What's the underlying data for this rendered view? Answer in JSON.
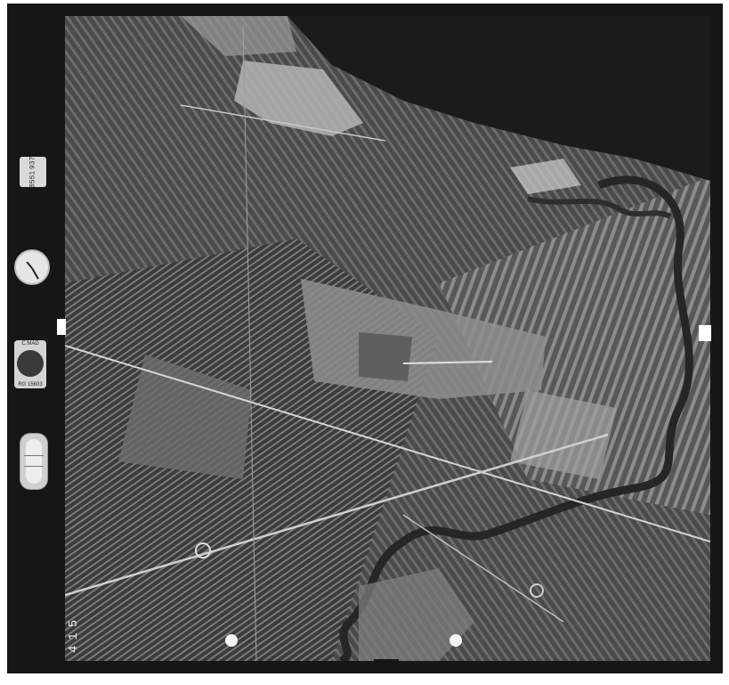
{
  "frame": {
    "number": "415",
    "counter_text": [
      "0551",
      "937"
    ]
  },
  "instruments": {
    "clock_icon": "clock-icon",
    "altimeter_icon": "altimeter-icon",
    "altimeter_top": "C.MAD",
    "altimeter_bottom": "RG 15603",
    "level_icon": "level-bubble-icon"
  },
  "colors": {
    "film_border": "#161616",
    "sea": "#1b1b1b",
    "fields_dark": "#3d3d3d",
    "fields_light": "#9c9c9c",
    "river": "#2a2a2a"
  }
}
